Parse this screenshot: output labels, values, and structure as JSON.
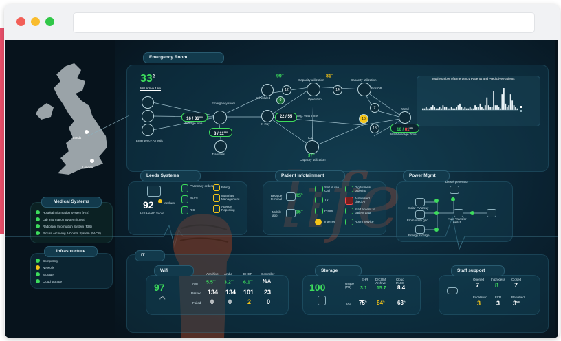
{
  "browser": {
    "dots": [
      "#f25f57",
      "#f9bc2e",
      "#31c748"
    ]
  },
  "map": {
    "city1": "Leeds",
    "city2": "London"
  },
  "medical": {
    "title": "Medical Systems",
    "items": [
      "Hospital Information System (HIS)",
      "Lab Information System (LIMS)",
      "Radiology Information System (RIS)",
      "Picture Archiving & Comm System (PACS)"
    ]
  },
  "infra": {
    "title": "Infrastructure",
    "items": [
      {
        "label": "Computing",
        "color": "#3ddc5c"
      },
      {
        "label": "Network",
        "color": "#f5c518"
      },
      {
        "label": "Storage",
        "color": "#3ddc5c"
      },
      {
        "label": "Cloud storage",
        "color": "#3ddc5c"
      }
    ]
  },
  "er": {
    "title": "Emergency Room",
    "arrivals_value": "33",
    "arrivals_sup": "2",
    "arrivals_note": "Will Arrive 15m",
    "emergency_arrivals": "Emergency Arrivals",
    "emergency_room": "Emergency room",
    "avg_flow": "16 / 36",
    "avg_flow_sup": "min",
    "avg_flow_label": "Average time",
    "transfer_flow": "8 / 11",
    "transfer_flow_sup": "min",
    "transfers": "Transfers",
    "xray": "X-Ray",
    "xray_flow": "22 / 55",
    "xray_flow_label": "Avg. Wait Time",
    "scheduled": "Scheduled",
    "scheduled_count": "12",
    "sub_count": "0",
    "top_pct": "99",
    "top_pct_sup": "%",
    "cap_util_1": "Capacity utilization",
    "cap_util_pct": "81",
    "cap_util_sup": "%",
    "operation": "Operation",
    "op_count": "14",
    "postop": "PostOP",
    "cap_util_2": "Capacity utilization",
    "right_count_1": "7",
    "right_count_2": "16",
    "right_count_3": "13",
    "ward": "Ward",
    "ward_flow_green": "16 /",
    "ward_flow_red": "81",
    "ward_flow_sup": "min",
    "ward_label": "Wait Average Time",
    "icu": "ICU",
    "icu_pct": "37",
    "icu_pct_sup": "%",
    "icu_cap": "Capacity utilization"
  },
  "chart_data": {
    "type": "bar",
    "title": "Total Number of Emergency Patients and Predictive Patients",
    "legend": [
      "",
      ""
    ],
    "values": [
      1,
      1,
      2,
      1,
      1,
      2,
      3,
      2,
      1,
      1,
      2,
      1,
      3,
      2,
      2,
      1,
      1,
      2,
      1,
      1,
      2,
      3,
      4,
      2,
      1,
      2,
      1,
      1,
      2,
      1,
      1,
      3,
      2,
      2,
      4,
      2,
      1,
      3,
      8,
      3,
      2,
      2,
      12,
      3,
      3,
      2,
      1,
      10,
      14,
      4,
      2,
      3,
      10,
      6,
      3,
      2,
      1
    ]
  },
  "leeds": {
    "title": "Leeds Systems",
    "score": "92",
    "score_label": "HIS Health Score",
    "score_dot": "Medium",
    "items": [
      "Pharmacy orders",
      "PACS",
      "RIS",
      "Billing",
      "Materials Management",
      "Agency Reporting"
    ]
  },
  "patient": {
    "title": "Patient Infotainment",
    "bedside": "Bedside terminal",
    "bedside_pct": "85",
    "bedside_sup": "%",
    "mobile": "Mobile app",
    "mobile_pct": "15",
    "mobile_sup": "%",
    "items": [
      "Self Nurse Call",
      "TV",
      "Phone",
      "Internet",
      "Digital meal ordering",
      "Automated check-in",
      "Staff access to patient data",
      "Room service"
    ]
  },
  "power": {
    "title": "Power Mgmt",
    "diesel": "Diesel generator",
    "solar": "Solar PV array",
    "utility": "From utility grid",
    "transfer": "Auto Transfer switch",
    "storage": "Energy storage"
  },
  "it": {
    "label": "IT"
  },
  "wifi": {
    "title": "Wifi",
    "score": "97",
    "cols": [
      "Aerohive",
      "Aruba",
      "DHCP",
      "Controller"
    ],
    "rows": [
      {
        "label": "Avg",
        "vals": [
          "5.5",
          "3.2",
          "6.1",
          "N/A"
        ],
        "units": [
          "ms",
          "ms",
          "ms",
          ""
        ]
      },
      {
        "label": "Passed",
        "vals": [
          "134",
          "134",
          "101",
          "23"
        ]
      },
      {
        "label": "Failed",
        "vals": [
          "0",
          "0",
          "2",
          "0"
        ]
      }
    ]
  },
  "storage": {
    "title": "Storage",
    "score": "100",
    "cols": [
      "Usage (TB)",
      "EHR",
      "DICOM Archive",
      "Cloud PACS"
    ],
    "row1": [
      "3.1",
      "15.7",
      "8.4"
    ],
    "row2_label": "I/%",
    "row2": [
      "75",
      "84",
      "63"
    ],
    "row2_sup": "%"
  },
  "staff": {
    "title": "Staff support",
    "cols1": [
      "Opened",
      "In process",
      "Closed"
    ],
    "vals1": [
      "7",
      "8",
      "7"
    ],
    "cols2": [
      "Escalation",
      "FCR",
      "Resolved"
    ],
    "vals2": [
      "3",
      "3",
      "3"
    ],
    "vals2_sup": "MIN"
  },
  "watermark": "life"
}
